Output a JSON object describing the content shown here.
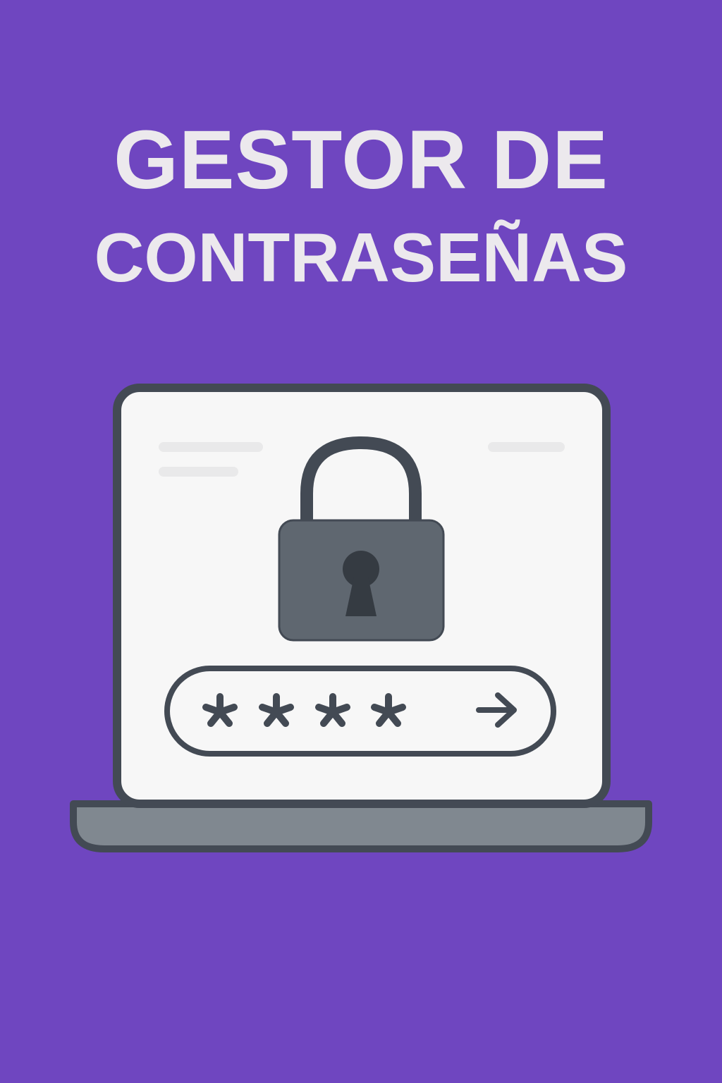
{
  "title": {
    "line1": "GESTOR DE",
    "line2": "CONTRASEÑAS"
  },
  "password_field": {
    "masked_value": "****",
    "submit_icon": "arrow-right-icon"
  },
  "icons": {
    "lock": "padlock-icon",
    "laptop": "laptop-icon"
  },
  "colors": {
    "background": "#6f46c0",
    "title_text": "#ece9ed",
    "outline": "#434a54",
    "lock_body": "#5f6770",
    "screen": "#f7f7f7",
    "laptop_base": "#808890"
  }
}
